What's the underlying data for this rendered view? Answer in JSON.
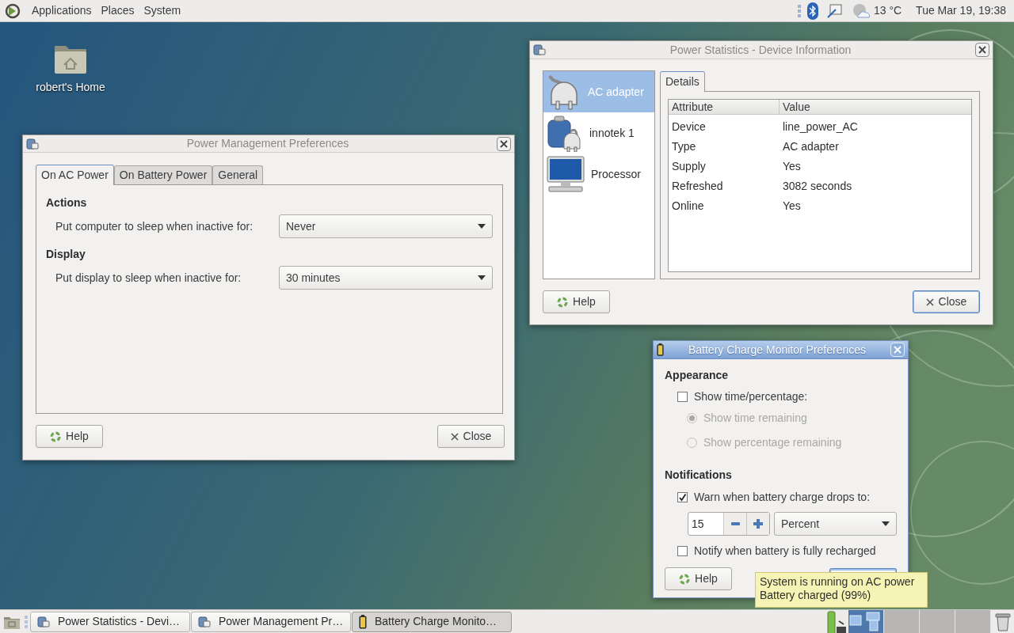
{
  "top_panel": {
    "menus": [
      "Applications",
      "Places",
      "System"
    ],
    "temperature": "13 °C",
    "clock": "Tue Mar 19, 19:38"
  },
  "desktop_icons": [
    {
      "label": "robert's Home"
    }
  ],
  "power_management": {
    "title": "Power Management Preferences",
    "active": false,
    "tabs": [
      {
        "label": "On AC Power",
        "selected": true
      },
      {
        "label": "On Battery Power",
        "selected": false
      },
      {
        "label": "General",
        "selected": false
      }
    ],
    "sections": [
      {
        "heading": "Actions",
        "label": "Put computer to sleep when inactive for:",
        "value": "Never"
      },
      {
        "heading": "Display",
        "label": "Put display to sleep when inactive for:",
        "value": "30 minutes"
      }
    ],
    "help_button": "Help",
    "close_button": "Close"
  },
  "power_statistics": {
    "title": "Power Statistics - Device Information",
    "active": false,
    "devices": [
      {
        "label": "AC adapter",
        "kind": "ac",
        "selected": true
      },
      {
        "label": "innotek 1",
        "kind": "battery",
        "selected": false
      },
      {
        "label": "Processor",
        "kind": "computer",
        "selected": false
      }
    ],
    "tabs": [
      {
        "label": "Details",
        "selected": true
      }
    ],
    "table": {
      "columns": [
        "Attribute",
        "Value"
      ],
      "rows": [
        [
          "Device",
          "line_power_AC"
        ],
        [
          "Type",
          "AC adapter"
        ],
        [
          "Supply",
          "Yes"
        ],
        [
          "Refreshed",
          "3082 seconds"
        ],
        [
          "Online",
          "Yes"
        ]
      ]
    },
    "help_button": "Help",
    "close_button": "Close"
  },
  "battery_prefs": {
    "title": "Battery Charge Monitor Preferences",
    "active": true,
    "appearance_heading": "Appearance",
    "show_option": {
      "label": "Show time/percentage:",
      "checked": false
    },
    "radios": [
      {
        "label": "Show time remaining",
        "selected": true,
        "disabled": true
      },
      {
        "label": "Show percentage remaining",
        "selected": false,
        "disabled": true
      }
    ],
    "notifications_heading": "Notifications",
    "warn_option": {
      "label": "Warn when battery charge drops to:",
      "checked": true
    },
    "threshold": "15",
    "unit": "Percent",
    "notify_option": {
      "label": "Notify when battery is fully recharged",
      "checked": false
    },
    "help_button": "Help"
  },
  "tooltip": {
    "lines": [
      "System is running on AC power",
      "Battery charged (99%)"
    ]
  },
  "taskbar": {
    "items": [
      {
        "label": "Power Statistics - Devi…",
        "kind": "app",
        "selected": false
      },
      {
        "label": "Power Management Pr…",
        "kind": "app",
        "selected": false
      },
      {
        "label": "Battery Charge Monito…",
        "kind": "battery",
        "selected": true
      }
    ],
    "workspaces": [
      {
        "selected": true
      },
      {
        "selected": false
      },
      {
        "selected": false
      },
      {
        "selected": false
      }
    ]
  }
}
